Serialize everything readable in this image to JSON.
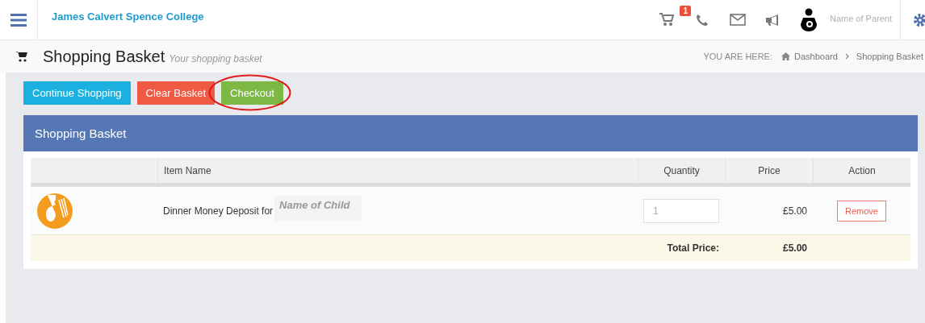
{
  "header": {
    "school_name": "James Calvert Spence College",
    "basket_count": "1",
    "parent_name": "Name of Parent"
  },
  "page": {
    "title": "Shopping Basket",
    "subtitle": "Your shopping basket",
    "breadcrumb_label": "YOU ARE HERE:",
    "breadcrumbs": [
      "Dashboard",
      "Shopping Basket"
    ]
  },
  "buttons": [
    {
      "label": "Continue Shopping",
      "kind": "info",
      "highlighted": false
    },
    {
      "label": "Clear Basket",
      "kind": "danger",
      "highlighted": false
    },
    {
      "label": "Checkout",
      "kind": "success",
      "highlighted": true
    }
  ],
  "panel": {
    "title": "Shopping Basket",
    "columns": [
      "Item Name",
      "Quantity",
      "Price",
      "Action"
    ],
    "rows": [
      {
        "item": "Dinner Money Deposit for",
        "child": "Name of Child",
        "quantity": "1",
        "price": "£5.00",
        "action": "Remove"
      }
    ],
    "total_label": "Total Price:",
    "total_value": "£5.00"
  }
}
